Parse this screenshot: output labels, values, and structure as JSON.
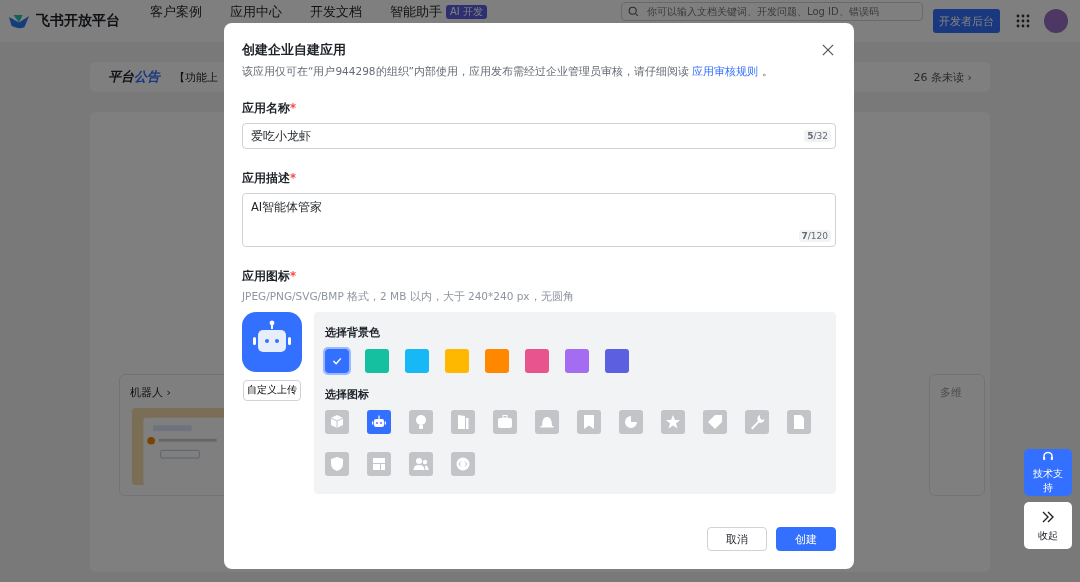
{
  "header": {
    "brand": "飞书开放平台",
    "nav": [
      {
        "label": "客户案例",
        "selected": false
      },
      {
        "label": "应用中心",
        "selected": false
      },
      {
        "label": "开发文档",
        "selected": false
      },
      {
        "label": "智能助手",
        "selected": false,
        "badge": "AI 开发"
      }
    ],
    "search": {
      "placeholder": "你可以输入文档关键词、开发问题、Log ID、错误码"
    },
    "console_button": "开发者后台"
  },
  "announcement": {
    "title_lead": "平台",
    "title_accent": "公告",
    "text": "【功能上",
    "unread": "26 条未读 ›"
  },
  "cards": [
    {
      "title": "机器人 ›"
    },
    {
      "title": "多维"
    }
  ],
  "dialog": {
    "title": "创建企业自建应用",
    "notice": "该应用仅可在“用户944298的组织”内部使用，应用发布需经过企业管理员审核，请仔细阅读",
    "notice_link": "应用审核规则",
    "notice_end": "。",
    "required_mark": "*",
    "name_label": "应用名称",
    "name_value": "爱吃小龙虾",
    "name_count": "5",
    "name_max": "/32",
    "desc_label": "应用描述",
    "desc_value": "AI智能体管家",
    "desc_count": "7",
    "desc_max": "/120",
    "icon_label": "应用图标",
    "icon_hint": "JPEG/PNG/SVG/BMP 格式，2 MB 以内，大于 240*240 px，无圆角",
    "upload_button": "自定义上传",
    "bg_label": "选择背景色",
    "colors": [
      {
        "color": "#3370ff",
        "selected": true
      },
      {
        "color": "#14c0a0",
        "selected": false
      },
      {
        "color": "#16b9f5",
        "selected": false
      },
      {
        "color": "#ffb800",
        "selected": false
      },
      {
        "color": "#ff8800",
        "selected": false
      },
      {
        "color": "#e8558e",
        "selected": false
      },
      {
        "color": "#a46cf0",
        "selected": false
      },
      {
        "color": "#5b5fe0",
        "selected": false
      }
    ],
    "icon_select_label": "选择图标",
    "icons": [
      {
        "kind": "cube",
        "selected": false
      },
      {
        "kind": "robot",
        "selected": true
      },
      {
        "kind": "bulb",
        "selected": false
      },
      {
        "kind": "door",
        "selected": false
      },
      {
        "kind": "briefcase",
        "selected": false
      },
      {
        "kind": "bell",
        "selected": false
      },
      {
        "kind": "bookmark",
        "selected": false
      },
      {
        "kind": "pie",
        "selected": false
      },
      {
        "kind": "star",
        "selected": false
      },
      {
        "kind": "tag",
        "selected": false
      },
      {
        "kind": "wrench",
        "selected": false
      },
      {
        "kind": "document",
        "selected": false
      },
      {
        "kind": "shield",
        "selected": false
      },
      {
        "kind": "layout",
        "selected": false
      },
      {
        "kind": "people",
        "selected": false
      },
      {
        "kind": "code",
        "selected": false
      }
    ],
    "buttons": [
      {
        "label": "取消",
        "kind": "secondary"
      },
      {
        "label": "创建",
        "kind": "primary"
      }
    ]
  },
  "float": {
    "support": "技术支持",
    "collapse": "收起"
  }
}
